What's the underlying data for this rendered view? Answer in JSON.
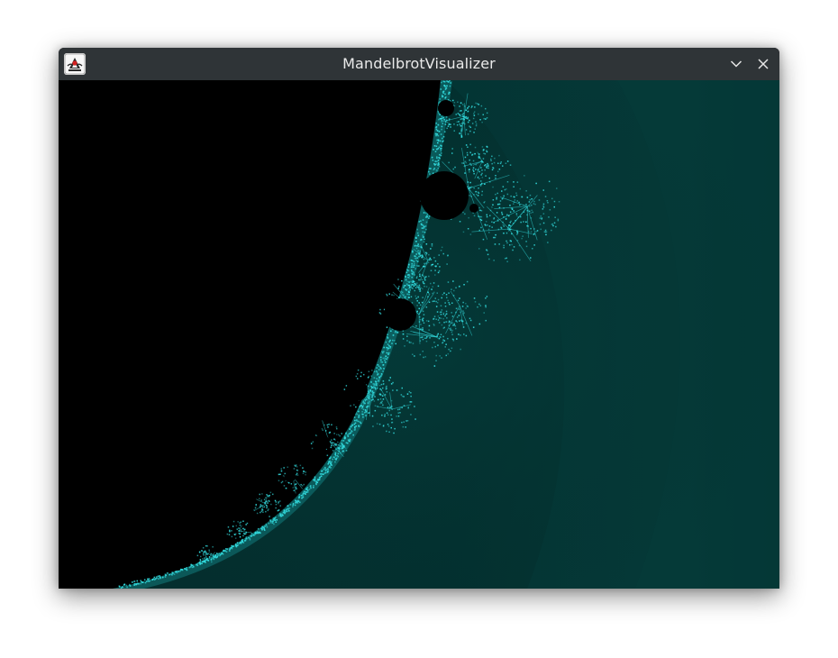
{
  "window": {
    "title": "MandelbrotVisualizer",
    "icons": {
      "app": "java-duke-icon",
      "minimize": "chevron-down-icon",
      "close": "close-icon"
    }
  },
  "render": {
    "set_color": "#000000",
    "background_color": "#03302f",
    "background_edge_color": "#083836",
    "filament_color": "#33dde0",
    "titlebar_color": "#2f3437"
  }
}
